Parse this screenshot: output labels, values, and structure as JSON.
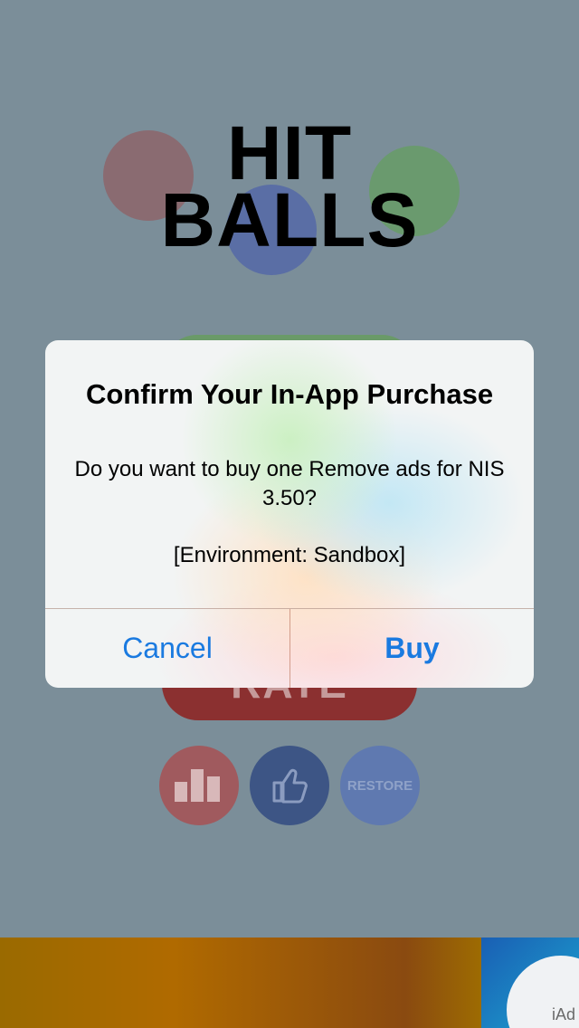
{
  "game": {
    "logo_line1": "HIT",
    "logo_line2": "BALLS",
    "rate_label": "RATE",
    "restore_label": "RESTORE",
    "buttons": {
      "scores_icon": "bar-chart-icon",
      "like_icon": "thumbs-up-icon"
    }
  },
  "dialog": {
    "title": "Confirm Your In-App Purchase",
    "message": "Do you want to buy one Remove ads for NIS 3.50?",
    "environment": "[Environment: Sandbox]",
    "cancel_label": "Cancel",
    "buy_label": "Buy",
    "accent_color": "#1a7ae0"
  },
  "ad": {
    "badge": "iAd"
  }
}
